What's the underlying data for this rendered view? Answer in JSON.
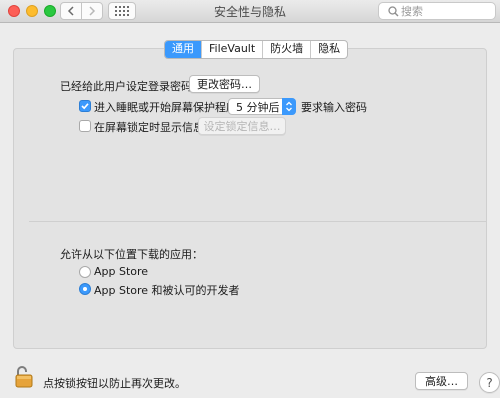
{
  "window": {
    "title": "安全性与隐私",
    "search_placeholder": "搜索"
  },
  "tabs": [
    {
      "label": "通用",
      "active": true
    },
    {
      "label": "FileVault",
      "active": false
    },
    {
      "label": "防火墙",
      "active": false
    },
    {
      "label": "隐私",
      "active": false
    }
  ],
  "general": {
    "password_set_label": "已经给此用户设定登录密码",
    "change_password_button": "更改密码…",
    "require_password": {
      "checked": true,
      "label": "进入睡眠或开始屏幕保护程序",
      "delay_value": "5 分钟后",
      "suffix": "要求输入密码"
    },
    "show_message": {
      "checked": false,
      "label": "在屏幕锁定时显示信息",
      "button": "设定锁定信息…"
    },
    "downloads": {
      "heading": "允许从以下位置下载的应用：",
      "options": [
        {
          "label": "App Store",
          "selected": false
        },
        {
          "label": "App Store 和被认可的开发者",
          "selected": true
        }
      ]
    }
  },
  "footer": {
    "lock_text": "点按锁按钮以防止再次更改。",
    "advanced_button": "高级…",
    "help_button": "?"
  },
  "colors": {
    "accent": "#3b99fc",
    "background": "#ececec",
    "panel": "#e3e3e3"
  }
}
